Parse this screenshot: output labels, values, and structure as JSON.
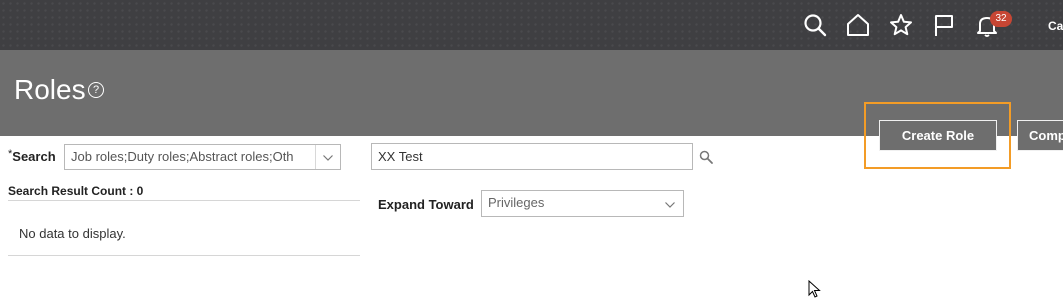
{
  "topbar": {
    "notification_count": "32",
    "user_initials": "Ca"
  },
  "header": {
    "title": "Roles",
    "help_symbol": "?",
    "create_role_label": "Create Role",
    "compare_label": "Comp"
  },
  "search": {
    "label": "Search",
    "required_marker": "*",
    "role_types_value": "Job roles;Duty roles;Abstract roles;Oth",
    "query_value": "XX Test"
  },
  "results": {
    "count_label": "Search Result Count : 0",
    "empty_message": "No data to display."
  },
  "expand": {
    "label": "Expand Toward",
    "selected": "Privileges"
  },
  "colors": {
    "accent_focus": "#f39c26",
    "badge": "#c74634",
    "header_bg": "#6e6e6e",
    "topbar_bg": "#3f3f42"
  }
}
